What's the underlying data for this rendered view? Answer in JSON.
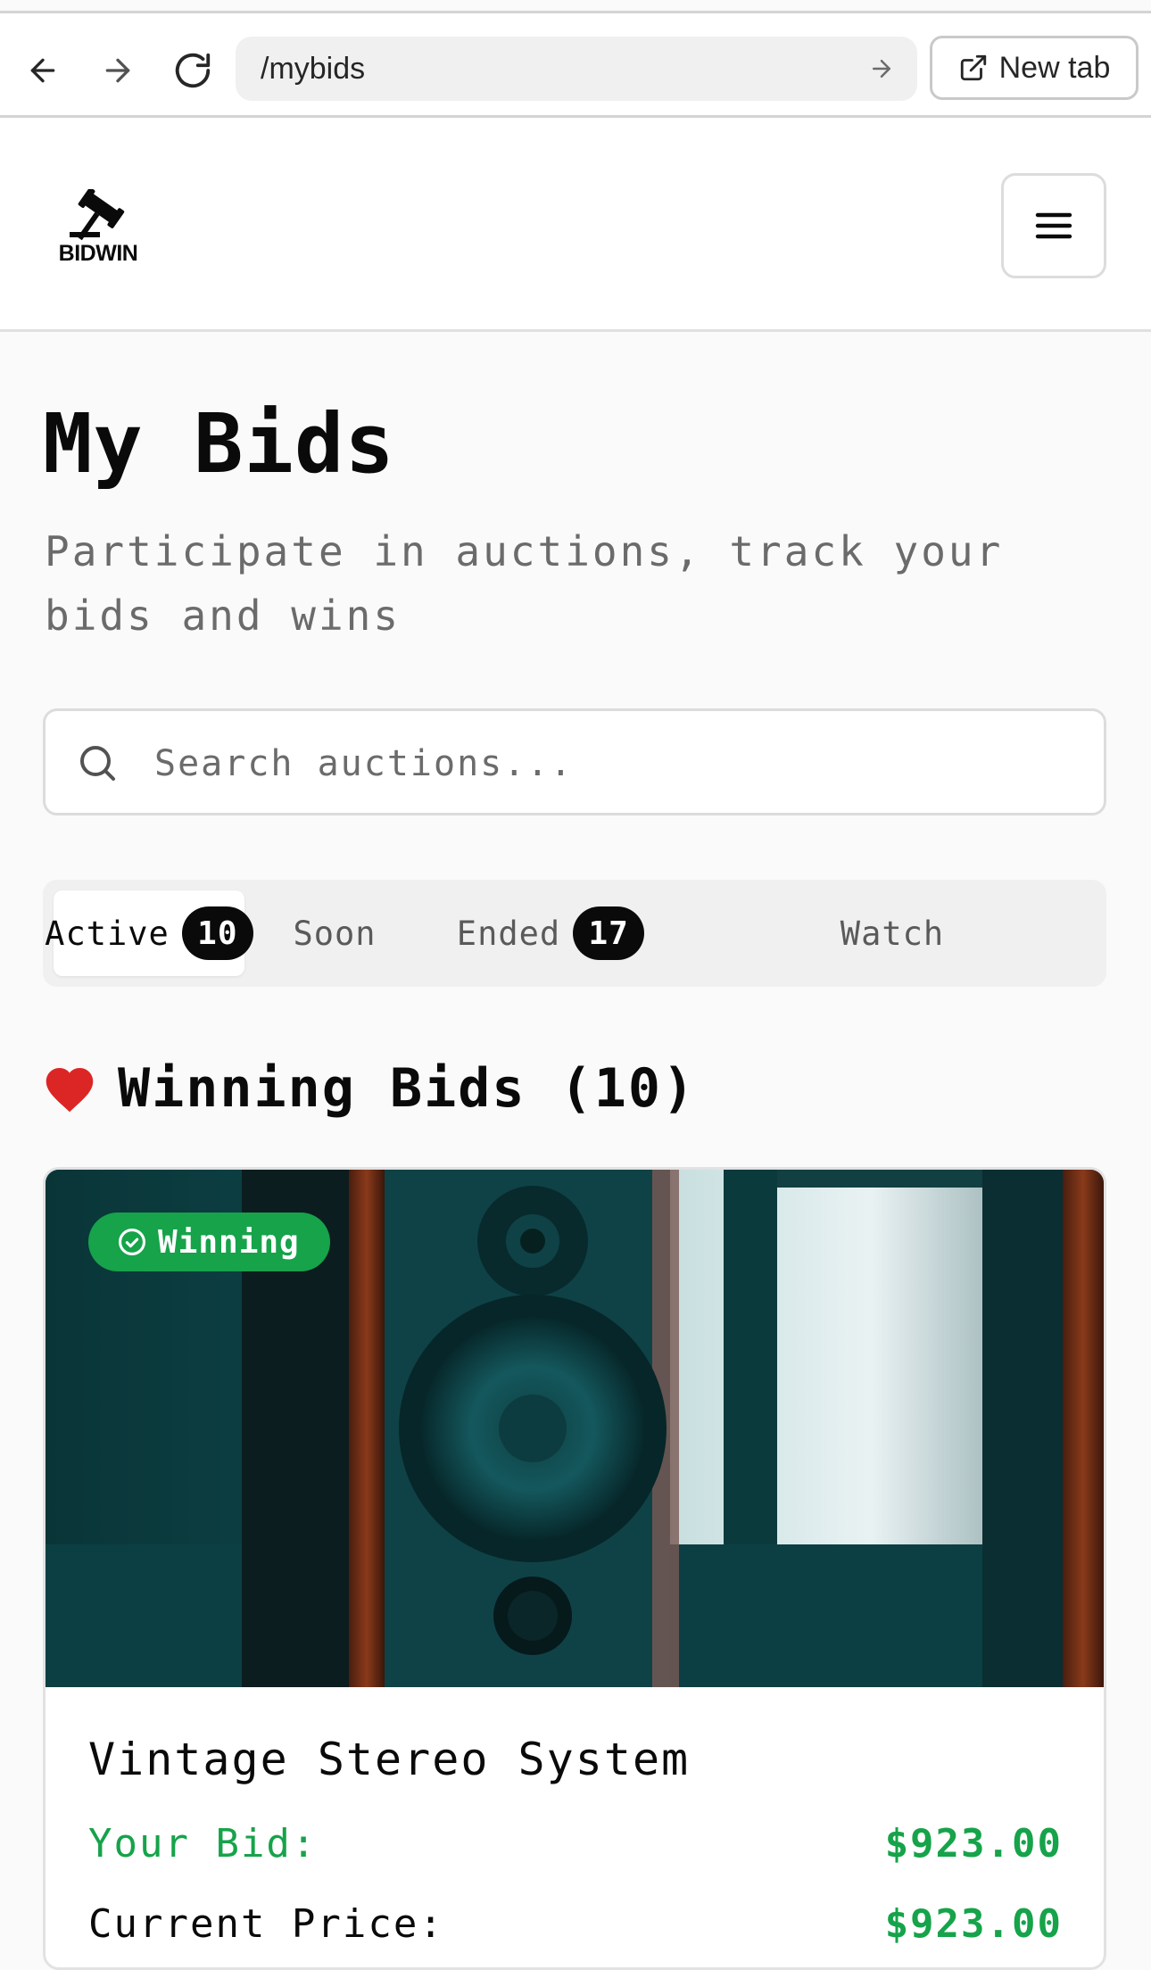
{
  "browser": {
    "url": "/mybids",
    "new_tab_label": "New tab"
  },
  "header": {
    "logo_text": "BIDWIN"
  },
  "page": {
    "title": "My Bids",
    "subtitle": "Participate in auctions, track your bids and wins"
  },
  "search": {
    "placeholder": "Search auctions...",
    "value": ""
  },
  "tabs": [
    {
      "label": "Active",
      "count": "10",
      "active": true
    },
    {
      "label": "Soon",
      "count": null,
      "active": false
    },
    {
      "label": "Ended",
      "count": "17",
      "active": false
    },
    {
      "label": "Watch",
      "count": null,
      "active": false
    }
  ],
  "section": {
    "title": "Winning Bids (10)",
    "icon": "heart-icon",
    "icon_color": "#dc2626"
  },
  "card": {
    "status": "Winning",
    "status_color": "#16a34a",
    "title": "Vintage Stereo System",
    "your_bid_label": "Your Bid:",
    "your_bid_value": "$923.00",
    "current_price_label": "Current Price:",
    "current_price_value": "$923.00"
  }
}
